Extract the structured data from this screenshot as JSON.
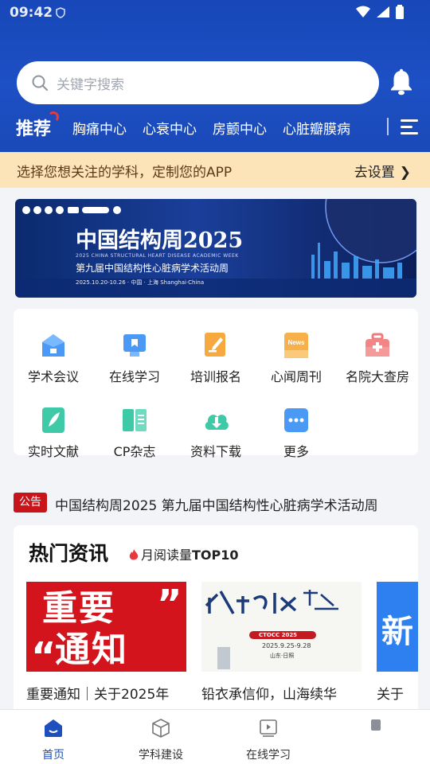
{
  "status_bar": {
    "time": "09:42"
  },
  "search": {
    "placeholder": "关键字搜索"
  },
  "categories": {
    "recommend": "推荐",
    "items": [
      "胸痛中心",
      "心衰中心",
      "房颤中心",
      "心脏瓣膜病"
    ]
  },
  "prompt": {
    "message": "选择您想关注的学科，定制您的APP",
    "action": "去设置"
  },
  "banner": {
    "title": "中国结构周2025",
    "subtitle_en": "2025 CHINA STRUCTURAL HEART DISEASE ACADEMIC WEEK",
    "subtitle_cn": "第九届中国结构性心脏病学术活动周",
    "date": "2025.10.20-10.26 · 中国 · 上海 Shanghai·China"
  },
  "grid": {
    "items": [
      {
        "label": "学术会议",
        "icon": "graduation-cap-icon",
        "color": "#3d8df0"
      },
      {
        "label": "在线学习",
        "icon": "monitor-icon",
        "color": "#3d8df0"
      },
      {
        "label": "培训报名",
        "icon": "pencil-note-icon",
        "color": "#f3a43a"
      },
      {
        "label": "心闻周刊",
        "icon": "news-icon",
        "color": "#f4a640",
        "badge": "News"
      },
      {
        "label": "名院大查房",
        "icon": "medical-kit-icon",
        "color": "#f07a7a"
      },
      {
        "label": "实时文献",
        "icon": "feather-doc-icon",
        "color": "#37c9a6"
      },
      {
        "label": "CP杂志",
        "icon": "open-book-icon",
        "color": "#37c9a6"
      },
      {
        "label": "资料下载",
        "icon": "cloud-download-icon",
        "color": "#37c9a6"
      },
      {
        "label": "更多",
        "icon": "more-dots-icon",
        "color": "#3d8df0"
      }
    ]
  },
  "notice": {
    "tag": "公告",
    "text": "中国结构周2025 第九届中国结构性心脏病学术活动周"
  },
  "hot": {
    "title": "热门资讯",
    "subtitle": "月阅读量",
    "subtitle_bold": "TOP10",
    "cards": [
      {
        "caption": "重要通知｜关于2025年",
        "image_text": [
          "重要",
          "通知"
        ]
      },
      {
        "caption": "铅衣承信仰，山海续华",
        "image_text": [
          "CTOCC 2025",
          "2025.9.25-9.28",
          "山东·日照"
        ]
      },
      {
        "caption": "关于"
      }
    ]
  },
  "tabbar": {
    "items": [
      {
        "label": "首页",
        "icon": "home-icon",
        "active": true
      },
      {
        "label": "学科建设",
        "icon": "cube-icon",
        "active": false
      },
      {
        "label": "在线学习",
        "icon": "video-icon",
        "active": false
      }
    ]
  },
  "colors": {
    "primary": "#1d50c4",
    "notice_red": "#c8151c",
    "prompt_bg": "#fde3b8"
  }
}
